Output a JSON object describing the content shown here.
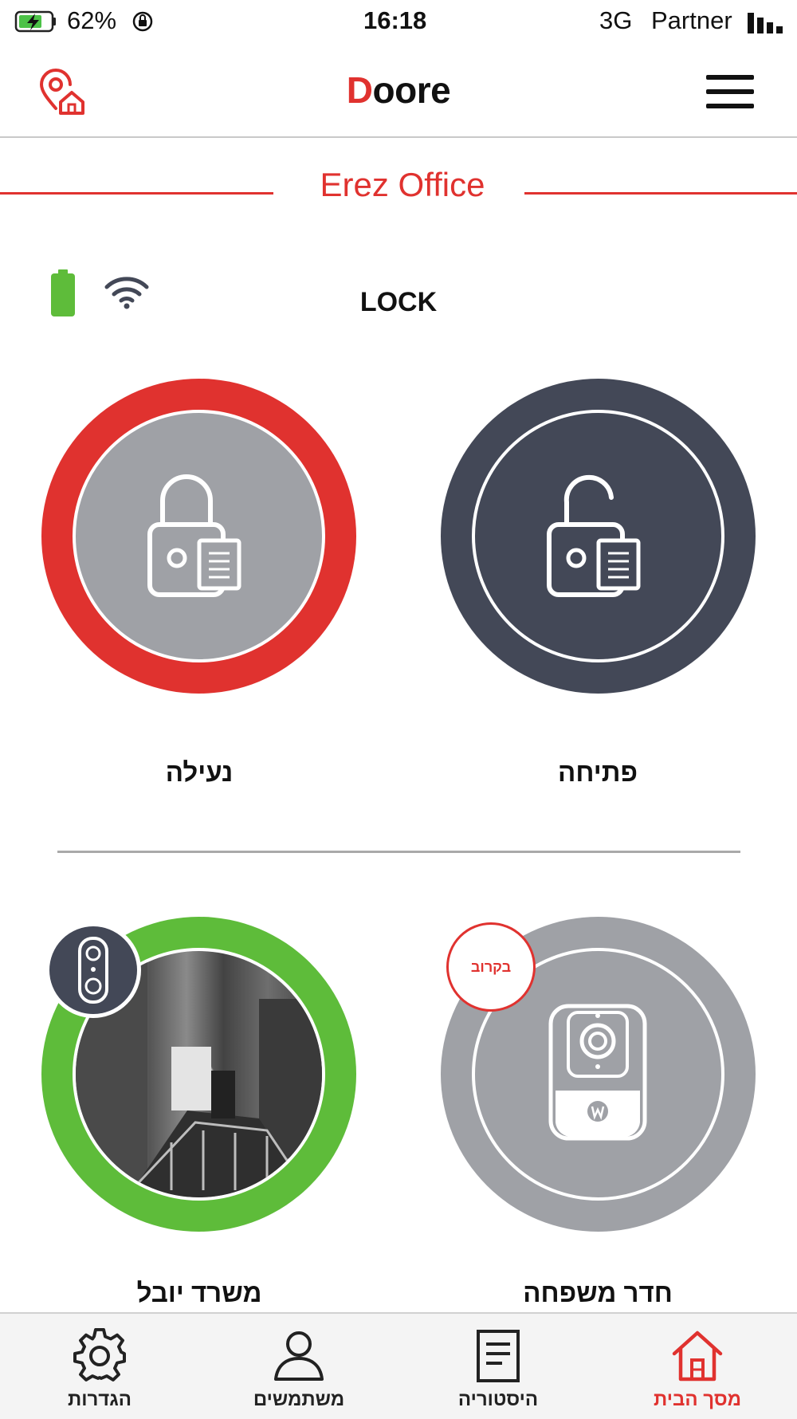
{
  "status_bar": {
    "battery_percent": "62%",
    "time": "16:18",
    "network": "3G",
    "carrier": "Partner"
  },
  "header": {
    "logo_first": "D",
    "logo_rest": "oore",
    "location_icon": "location-home-icon",
    "menu_icon": "hamburger-menu-icon"
  },
  "location": {
    "title": "Erez Office"
  },
  "lock_status": {
    "label": "LOCK",
    "battery_icon": "battery-full-icon",
    "wifi_icon": "wifi-icon"
  },
  "actions": [
    {
      "label": "פתיחה",
      "icon": "unlocked-padlock-icon"
    },
    {
      "label": "נעילה",
      "icon": "locked-padlock-icon"
    }
  ],
  "devices": [
    {
      "label": "חדר משפחה",
      "badge": "בקרוב",
      "icon": "camera-icon"
    },
    {
      "label": "משרד יובל",
      "icon": "doorbell-icon"
    }
  ],
  "bottom_nav": [
    {
      "label": "מסך הבית",
      "icon": "home-icon",
      "active": true
    },
    {
      "label": "היסטוריה",
      "icon": "document-icon",
      "active": false
    },
    {
      "label": "משתמשים",
      "icon": "user-icon",
      "active": false
    },
    {
      "label": "הגדרות",
      "icon": "gear-icon",
      "active": false
    }
  ],
  "colors": {
    "brand_red": "#e0322f",
    "dark_slate": "#434857",
    "gray": "#9fa1a6",
    "green": "#5ebc3a"
  }
}
